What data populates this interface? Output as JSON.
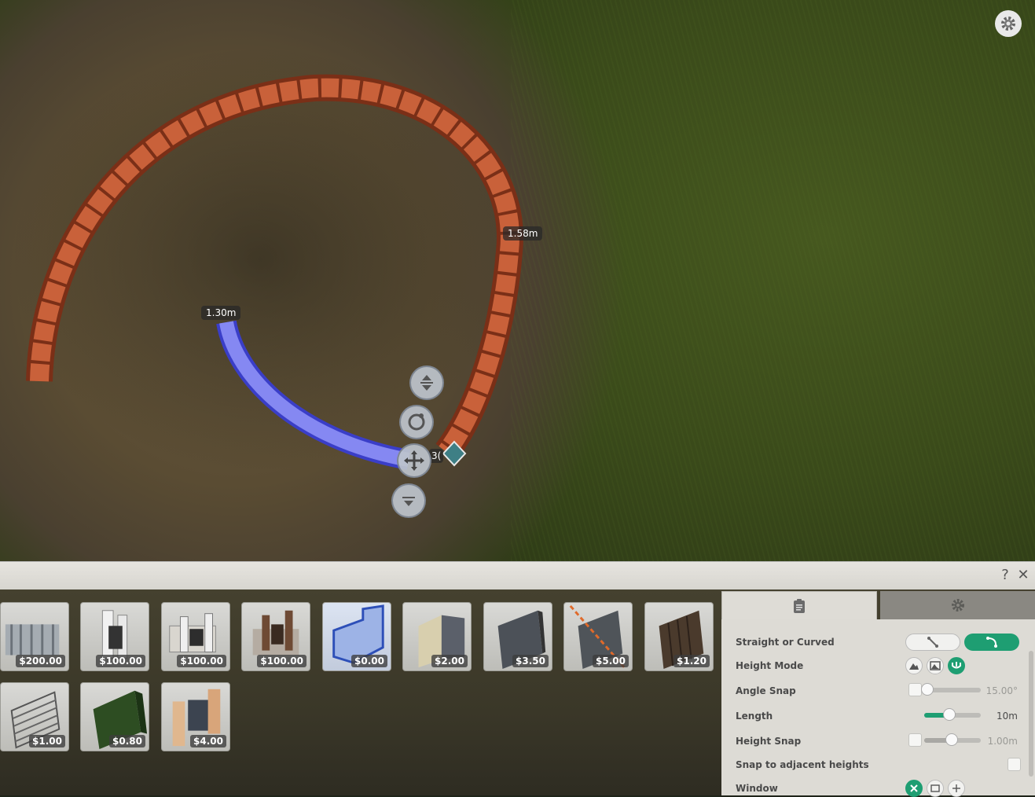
{
  "viewport": {
    "measure_labels": [
      "1.30m",
      "1.58m",
      "3("
    ],
    "gizmo_icons": [
      "vertical-move-icon",
      "rotate-icon",
      "move-icon",
      "lower-icon"
    ]
  },
  "panel": {
    "help_label": "?",
    "close_label": "✕"
  },
  "items": [
    {
      "price": "$200.00",
      "icon": "iron-gate-fence"
    },
    {
      "price": "$100.00",
      "icon": "white-pillar-fence"
    },
    {
      "price": "$100.00",
      "icon": "stone-wall-gate"
    },
    {
      "price": "$100.00",
      "icon": "wood-post-wall"
    },
    {
      "price": "$0.00",
      "icon": "blueprint-wall",
      "selected": true
    },
    {
      "price": "$2.00",
      "icon": "plaster-wall"
    },
    {
      "price": "$3.50",
      "icon": "slate-wall"
    },
    {
      "price": "$5.00",
      "icon": "glass-wall"
    },
    {
      "price": "$1.20",
      "icon": "wood-plank-wall"
    },
    {
      "price": "$1.00",
      "icon": "rail-fence"
    },
    {
      "price": "$0.80",
      "icon": "hedge-wall"
    },
    {
      "price": "$4.00",
      "icon": "brick-pillar-wall"
    }
  ],
  "side_panel": {
    "tabs": [
      "info-icon",
      "gear-icon"
    ],
    "rows": {
      "straight_or_curved": "Straight or Curved",
      "height_mode": "Height Mode",
      "angle_snap": "Angle Snap",
      "angle_snap_value": "15.00°",
      "angle_snap_level": 0.05,
      "length": "Length",
      "length_value": "10m",
      "length_level": 0.45,
      "height_snap": "Height Snap",
      "height_snap_value": "1.00m",
      "height_snap_level": 0.48,
      "snap_adjacent": "Snap to adjacent heights",
      "window": "Window"
    },
    "colors": {
      "accent": "#1e9e72"
    }
  }
}
